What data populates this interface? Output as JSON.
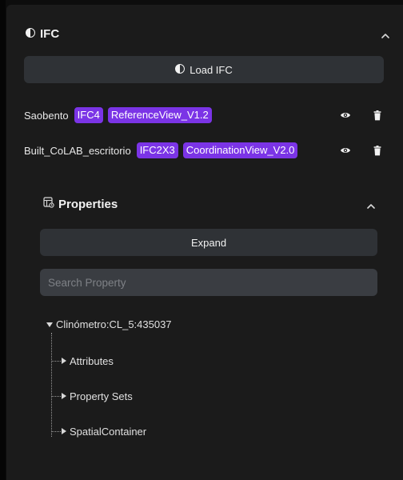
{
  "panel": {
    "title": "IFC",
    "load_button_label": "Load IFC"
  },
  "models": [
    {
      "name": "Saobento",
      "schema": "IFC4",
      "view": "ReferenceView_V1.2"
    },
    {
      "name": "Built_CoLAB_escritorio",
      "schema": "IFC2X3",
      "view": "CoordinationView_V2.0"
    }
  ],
  "properties": {
    "title": "Properties",
    "expand_label": "Expand",
    "search_placeholder": "Search Property",
    "tree": {
      "root_label": "Clinómetro:CL_5:435037",
      "children": [
        "Attributes",
        "Property Sets",
        "SpatialContainer"
      ]
    }
  },
  "colors": {
    "panel_background": "#1b1b1b",
    "button_background": "#2f3236",
    "input_background": "#3a3d42",
    "tag_background": "#7b34e6",
    "text": "#e6e6e6"
  },
  "icons": {
    "ifc_header": "ifc-cube-icon",
    "collapse": "chevron-up-icon",
    "load": "ifc-cube-icon",
    "visibility": "eye-icon",
    "delete": "trash-icon",
    "properties": "properties-table-icon",
    "tree_expanded": "caret-down-icon",
    "tree_collapsed": "caret-right-icon"
  }
}
